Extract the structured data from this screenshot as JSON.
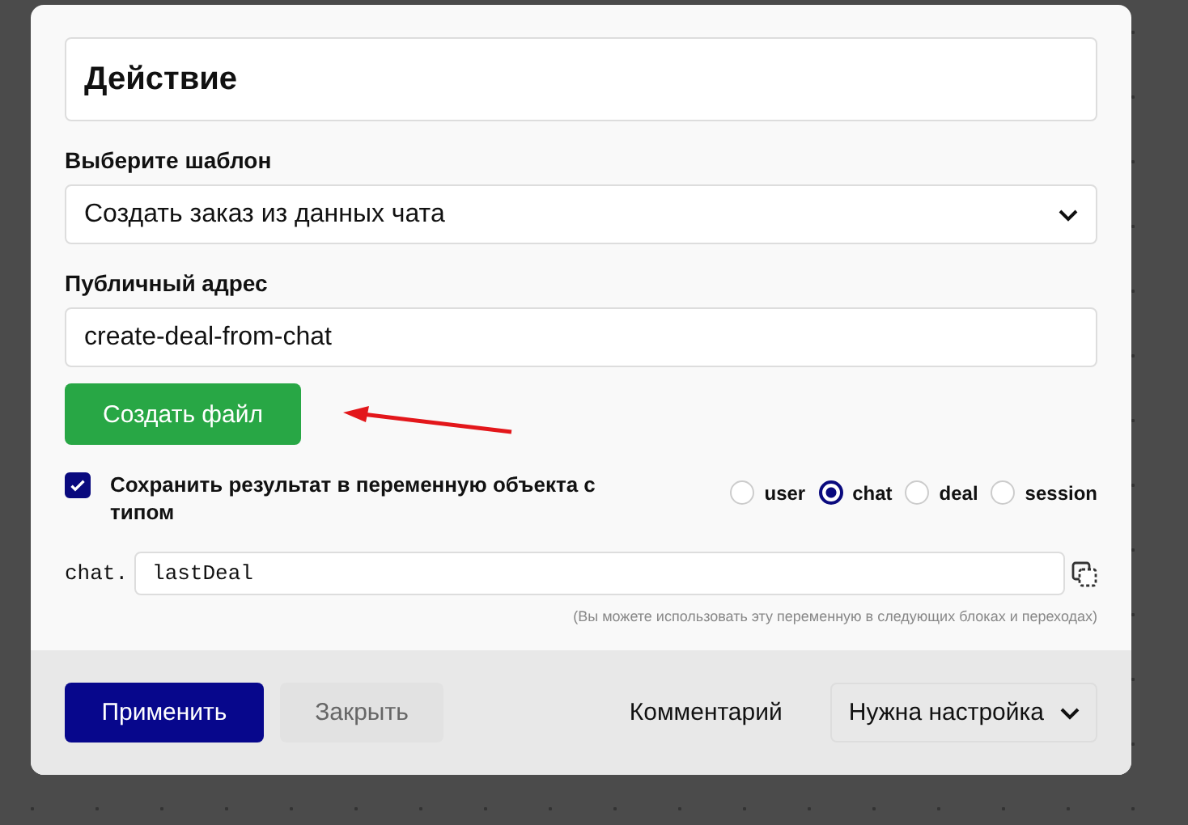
{
  "dialog": {
    "title_field": {
      "value": "Действие"
    },
    "template": {
      "label": "Выберите шаблон",
      "value": "Создать заказ из данных чата"
    },
    "public_address": {
      "label": "Публичный адрес",
      "value": "create-deal-from-chat"
    },
    "create_button": {
      "label": "Создать файл"
    },
    "save_result": {
      "checked": true,
      "label": "Сохранить результат в переменную объекта с типом"
    },
    "scopes": [
      {
        "label": "user",
        "selected": false
      },
      {
        "label": "chat",
        "selected": true
      },
      {
        "label": "deal",
        "selected": false
      },
      {
        "label": "session",
        "selected": false
      }
    ],
    "variable": {
      "prefix": "chat.",
      "value": "lastDeal",
      "hint": "(Вы можете использовать эту переменную в следующих блоках и переходах)"
    },
    "footer": {
      "apply_button": {
        "label": "Применить",
        "disabled": false
      },
      "close_button": {
        "label": "Закрыть",
        "disabled": true
      },
      "comment_link": "Комментарий",
      "status_dropdown": {
        "value": "Нужна настройка"
      }
    }
  }
}
